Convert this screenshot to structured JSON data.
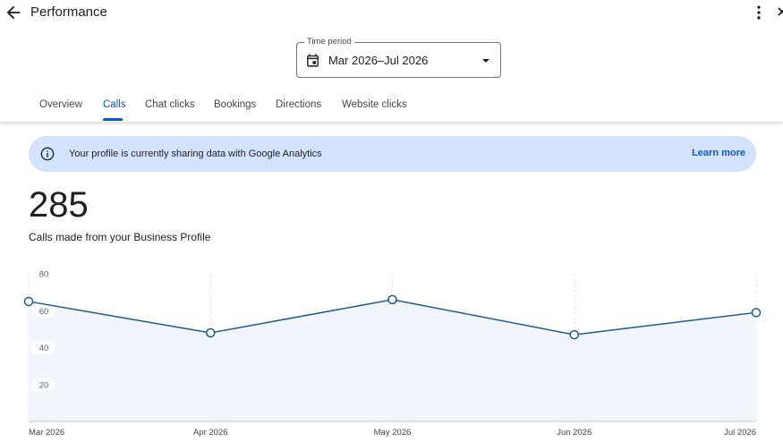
{
  "header": {
    "title": "Performance",
    "back_icon": "arrow-left-icon",
    "more_icon": "more-vert-icon",
    "close_icon": "close-icon"
  },
  "time_period": {
    "label": "Time period",
    "value": "Mar 2026–Jul 2026",
    "icon": "calendar-icon"
  },
  "tabs": [
    {
      "label": "Overview",
      "active": false
    },
    {
      "label": "Calls",
      "active": true
    },
    {
      "label": "Chat clicks",
      "active": false
    },
    {
      "label": "Bookings",
      "active": false
    },
    {
      "label": "Directions",
      "active": false
    },
    {
      "label": "Website clicks",
      "active": false
    }
  ],
  "banner": {
    "text": "Your profile is currently sharing data with Google Analytics",
    "link": "Learn more",
    "icon": "info-icon"
  },
  "summary": {
    "value": "285",
    "label": "Calls made from your Business Profile"
  },
  "colors": {
    "accent": "#0b57d0",
    "banner_bg": "#d3e3fd",
    "line": "#1f5a8c",
    "area_fill": "#f1f6fc"
  },
  "chart_data": {
    "type": "area",
    "x": [
      "Mar 2026",
      "Apr 2026",
      "May 2026",
      "Jun 2026",
      "Jul 2026"
    ],
    "values": [
      65,
      48,
      66,
      47,
      59
    ],
    "yticks": [
      20,
      40,
      60,
      80
    ],
    "ylim": [
      0,
      80
    ],
    "grid": "vertical-dashed"
  }
}
